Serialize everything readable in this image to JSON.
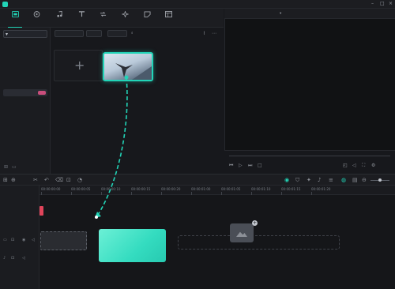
{
  "app": {
    "name": "",
    "window_title": ""
  },
  "menu": [
    {
      "label": ""
    },
    {
      "label": ""
    },
    {
      "label": ""
    },
    {
      "label": ""
    },
    {
      "label": ""
    }
  ],
  "toolbar": {
    "tabs": [
      {
        "label": "",
        "icon": "media-icon",
        "active": true
      },
      {
        "label": "",
        "icon": "stock-media-icon"
      },
      {
        "label": "",
        "icon": "audio-icon"
      },
      {
        "label": "",
        "icon": "titles-icon"
      },
      {
        "label": "",
        "icon": "transitions-icon"
      },
      {
        "label": "",
        "icon": "effects-icon"
      },
      {
        "label": "",
        "icon": "stickers-icon"
      },
      {
        "label": "",
        "icon": "templates-icon"
      }
    ]
  },
  "sidebar": {
    "project_media_label": "",
    "items": [
      {
        "label": ""
      },
      {
        "label": ""
      },
      {
        "label": ""
      },
      {
        "label": ""
      },
      {
        "label": "",
        "selected": true,
        "badge": true
      }
    ]
  },
  "media": {
    "filters": [
      {
        "label": ""
      },
      {
        "label": ""
      },
      {
        "label": ""
      }
    ],
    "search_placeholder": "",
    "folder_label": "",
    "import_label": "",
    "thumb_duration": ""
  },
  "preview": {
    "tab_player": "",
    "tab_quality": ""
  },
  "timeline": {
    "ruler_ticks": [
      "00:00:00:00",
      "00:00:00:05",
      "00:00:00:10",
      "00:00:00:15",
      "00:00:00:20",
      "00:00:01:00",
      "00:00:01:05",
      "00:00:01:10",
      "00:00:01:15",
      "00:00:01:20"
    ],
    "empty_hint": ""
  },
  "tooltip": {
    "title": "",
    "body": "",
    "step": ""
  },
  "colors": {
    "accent": "#22d4b7",
    "playhead": "#e0445a",
    "background": "#17181c",
    "panel": "#1c1d21"
  }
}
